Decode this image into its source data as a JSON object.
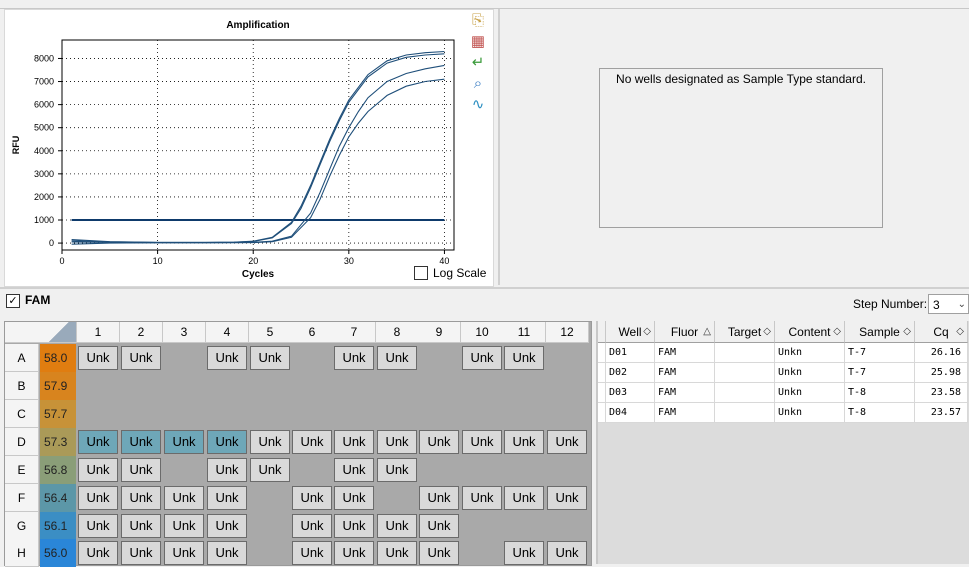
{
  "chart": {
    "toolbar_icons": [
      "copy-icon",
      "chart-settings-icon",
      "export-icon",
      "zoom-icon",
      "curve-fit-icon"
    ],
    "log_scale_label": "Log Scale",
    "log_scale_checked": false
  },
  "chart_data": {
    "type": "line",
    "title": "Amplification",
    "xlabel": "Cycles",
    "ylabel": "RFU",
    "xlim": [
      0,
      41
    ],
    "ylim": [
      -300,
      8800
    ],
    "xticks": [
      0,
      10,
      20,
      30,
      40
    ],
    "yticks": [
      0,
      1000,
      2000,
      3000,
      4000,
      5000,
      6000,
      7000,
      8000
    ],
    "grid": true,
    "threshold": 1000,
    "series": [
      {
        "x": [
          1,
          5,
          10,
          15,
          18,
          20,
          22,
          24,
          25,
          26,
          27,
          28,
          29,
          30,
          32,
          34,
          36,
          38,
          40
        ],
        "y": [
          100,
          50,
          30,
          30,
          40,
          80,
          250,
          900,
          1600,
          2500,
          3500,
          4500,
          5400,
          6200,
          7300,
          7900,
          8150,
          8250,
          8300
        ]
      },
      {
        "x": [
          1,
          5,
          10,
          15,
          18,
          20,
          22,
          24,
          25,
          26,
          27,
          28,
          29,
          30,
          32,
          34,
          36,
          38,
          40
        ],
        "y": [
          150,
          60,
          30,
          30,
          40,
          70,
          230,
          850,
          1500,
          2400,
          3400,
          4400,
          5300,
          6100,
          7200,
          7800,
          8050,
          8150,
          8200
        ]
      },
      {
        "x": [
          1,
          5,
          10,
          15,
          20,
          22,
          24,
          26,
          27,
          28,
          29,
          30,
          31,
          32,
          34,
          36,
          38,
          40
        ],
        "y": [
          50,
          30,
          20,
          20,
          30,
          80,
          300,
          1300,
          2200,
          3200,
          4200,
          5000,
          5700,
          6300,
          7000,
          7350,
          7550,
          7700
        ]
      },
      {
        "x": [
          1,
          5,
          10,
          15,
          20,
          22,
          24,
          26,
          27,
          28,
          29,
          30,
          31,
          32,
          34,
          36,
          38,
          40
        ],
        "y": [
          -50,
          0,
          10,
          10,
          20,
          60,
          250,
          1100,
          1900,
          2900,
          3800,
          4600,
          5200,
          5700,
          6400,
          6800,
          7000,
          7100
        ]
      }
    ]
  },
  "std_curve": {
    "message": "No wells designated as Sample Type standard."
  },
  "fluor_bar": {
    "checked": true,
    "label": "FAM",
    "step_label": "Step Number:",
    "step_value": "3"
  },
  "plate": {
    "columns": [
      "1",
      "2",
      "3",
      "4",
      "5",
      "6",
      "7",
      "8",
      "9",
      "10",
      "11",
      "12"
    ],
    "rows": [
      {
        "label": "A",
        "temp": "58.0",
        "tcolor": "#e07d10",
        "wells": [
          1,
          1,
          0,
          1,
          1,
          0,
          1,
          1,
          0,
          1,
          1,
          0
        ]
      },
      {
        "label": "B",
        "temp": "57.9",
        "tcolor": "#d8841e",
        "wells": [
          0,
          0,
          0,
          0,
          0,
          0,
          0,
          0,
          0,
          0,
          0,
          0
        ]
      },
      {
        "label": "C",
        "temp": "57.7",
        "tcolor": "#c79238",
        "wells": [
          0,
          0,
          0,
          0,
          0,
          0,
          0,
          0,
          0,
          0,
          0,
          0
        ]
      },
      {
        "label": "D",
        "temp": "57.3",
        "tcolor": "#aa9a58",
        "wells": [
          2,
          2,
          2,
          2,
          1,
          1,
          1,
          1,
          1,
          1,
          1,
          1
        ]
      },
      {
        "label": "E",
        "temp": "56.8",
        "tcolor": "#8a9e78",
        "wells": [
          1,
          1,
          0,
          1,
          1,
          0,
          1,
          1,
          0,
          0,
          0,
          0
        ]
      },
      {
        "label": "F",
        "temp": "56.4",
        "tcolor": "#5c97a8",
        "wells": [
          1,
          1,
          1,
          1,
          0,
          1,
          1,
          0,
          1,
          1,
          1,
          1
        ]
      },
      {
        "label": "G",
        "temp": "56.1",
        "tcolor": "#3b8ec4",
        "wells": [
          1,
          1,
          1,
          1,
          0,
          1,
          1,
          1,
          1,
          0,
          0,
          0
        ]
      },
      {
        "label": "H",
        "temp": "56.0",
        "tcolor": "#2a86d8",
        "wells": [
          1,
          1,
          1,
          1,
          0,
          1,
          1,
          1,
          1,
          0,
          1,
          1
        ]
      }
    ],
    "well_label": "Unk"
  },
  "table": {
    "columns": [
      "Well",
      "Fluor",
      "Target",
      "Content",
      "Sample",
      "Cq"
    ],
    "rows": [
      [
        "D01",
        "FAM",
        "",
        "Unkn",
        "T-7",
        "26.16"
      ],
      [
        "D02",
        "FAM",
        "",
        "Unkn",
        "T-7",
        "25.98"
      ],
      [
        "D03",
        "FAM",
        "",
        "Unkn",
        "T-8",
        "23.58"
      ],
      [
        "D04",
        "FAM",
        "",
        "Unkn",
        "T-8",
        "23.57"
      ]
    ]
  }
}
